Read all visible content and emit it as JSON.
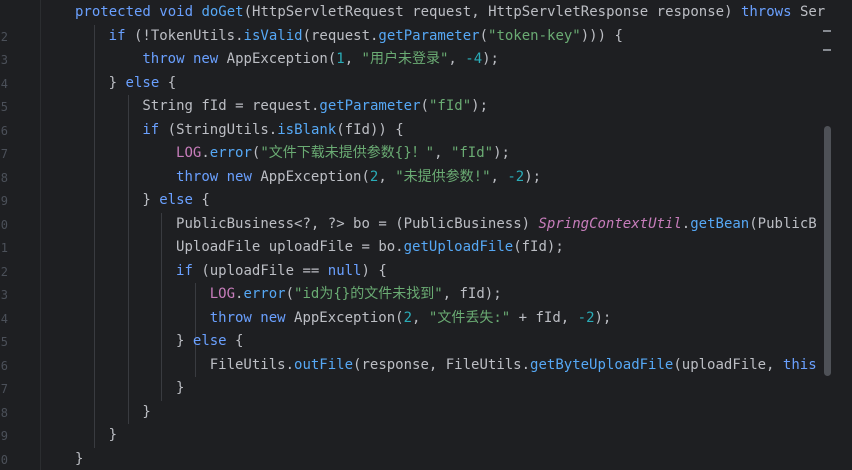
{
  "gutter": {
    "line_numbers": [
      "",
      "2",
      "3",
      "4",
      "5",
      "6",
      "7",
      "8",
      "9",
      "0",
      "1",
      "2",
      "3",
      "4",
      "5",
      "6",
      "7",
      "8",
      "9",
      "0"
    ]
  },
  "code": {
    "lines": [
      {
        "indent": 1,
        "tokens": [
          [
            "k2",
            "protected "
          ],
          [
            "k2",
            "void "
          ],
          [
            "fn",
            "doGet"
          ],
          [
            "tp",
            "("
          ],
          [
            "tp",
            "HttpServletRequest "
          ],
          [
            "tp",
            "request, "
          ],
          [
            "tp",
            "HttpServletResponse "
          ],
          [
            "tp",
            "response) "
          ],
          [
            "k2",
            "throws "
          ],
          [
            "tp",
            "Ser"
          ]
        ]
      },
      {
        "indent": 2,
        "tokens": [
          [
            "k2",
            "if "
          ],
          [
            "tp",
            "(!"
          ],
          [
            "tp",
            "TokenUtils."
          ],
          [
            "fn",
            "isValid"
          ],
          [
            "tp",
            "(request."
          ],
          [
            "fn",
            "getParameter"
          ],
          [
            "tp",
            "("
          ],
          [
            "s",
            "\"token-key\""
          ],
          [
            "tp",
            ")))"
          ],
          [
            "tp",
            " {"
          ]
        ]
      },
      {
        "indent": 3,
        "tokens": [
          [
            "k2",
            "throw "
          ],
          [
            "k2",
            "new "
          ],
          [
            "tp",
            "AppException"
          ],
          [
            "tp",
            "("
          ],
          [
            "n",
            "1"
          ],
          [
            "tp",
            ", "
          ],
          [
            "s",
            "\"用户未登录\""
          ],
          [
            "tp",
            ", "
          ],
          [
            "n",
            "-4"
          ],
          [
            "tp",
            ");"
          ]
        ]
      },
      {
        "indent": 2,
        "tokens": [
          [
            "tp",
            "} "
          ],
          [
            "k2",
            "else "
          ],
          [
            "tp",
            "{"
          ]
        ]
      },
      {
        "indent": 3,
        "tokens": [
          [
            "tp",
            "String "
          ],
          [
            "tp",
            "fId = request."
          ],
          [
            "fn",
            "getParameter"
          ],
          [
            "tp",
            "("
          ],
          [
            "s",
            "\"fId\""
          ],
          [
            "tp",
            ");"
          ]
        ]
      },
      {
        "indent": 3,
        "tokens": [
          [
            "k2",
            "if "
          ],
          [
            "tp",
            "(StringUtils."
          ],
          [
            "fn",
            "isBlank"
          ],
          [
            "tp",
            "(fId)) {"
          ]
        ]
      },
      {
        "indent": 4,
        "tokens": [
          [
            "fd",
            "LOG"
          ],
          [
            "tp",
            "."
          ],
          [
            "fn",
            "error"
          ],
          [
            "tp",
            "("
          ],
          [
            "s",
            "\"文件下载未提供参数{}！\""
          ],
          [
            "tp",
            ", "
          ],
          [
            "s",
            "\"fId\""
          ],
          [
            "tp",
            ");"
          ]
        ]
      },
      {
        "indent": 4,
        "tokens": [
          [
            "k2",
            "throw "
          ],
          [
            "k2",
            "new "
          ],
          [
            "tp",
            "AppException"
          ],
          [
            "tp",
            "("
          ],
          [
            "n",
            "2"
          ],
          [
            "tp",
            ", "
          ],
          [
            "s",
            "\"未提供参数!\""
          ],
          [
            "tp",
            ", "
          ],
          [
            "n",
            "-2"
          ],
          [
            "tp",
            ");"
          ]
        ]
      },
      {
        "indent": 3,
        "tokens": [
          [
            "tp",
            "} "
          ],
          [
            "k2",
            "else "
          ],
          [
            "tp",
            "{"
          ]
        ]
      },
      {
        "indent": 4,
        "tokens": [
          [
            "tp",
            "PublicBusiness"
          ],
          [
            "tp",
            "<?, ?> bo = ("
          ],
          [
            "tp",
            "PublicBusiness"
          ],
          [
            "tp",
            ") "
          ],
          [
            "st",
            "SpringContextUtil"
          ],
          [
            "tp",
            "."
          ],
          [
            "fn",
            "getBean"
          ],
          [
            "tp",
            "(PublicB"
          ]
        ]
      },
      {
        "indent": 4,
        "tokens": [
          [
            "tp",
            "UploadFile "
          ],
          [
            "tp",
            "uploadFile = bo."
          ],
          [
            "fn",
            "getUploadFile"
          ],
          [
            "tp",
            "(fId);"
          ]
        ]
      },
      {
        "indent": 4,
        "tokens": [
          [
            "k2",
            "if "
          ],
          [
            "tp",
            "(uploadFile == "
          ],
          [
            "k2",
            "null"
          ],
          [
            "tp",
            ") {"
          ]
        ]
      },
      {
        "indent": 5,
        "tokens": [
          [
            "fd",
            "LOG"
          ],
          [
            "tp",
            "."
          ],
          [
            "fn",
            "error"
          ],
          [
            "tp",
            "("
          ],
          [
            "s",
            "\"id为{}的文件未找到\""
          ],
          [
            "tp",
            ", fId);"
          ]
        ]
      },
      {
        "indent": 5,
        "tokens": [
          [
            "k2",
            "throw "
          ],
          [
            "k2",
            "new "
          ],
          [
            "tp",
            "AppException"
          ],
          [
            "tp",
            "("
          ],
          [
            "n",
            "2"
          ],
          [
            "tp",
            ", "
          ],
          [
            "s",
            "\"文件丢失:\""
          ],
          [
            "tp",
            " + fId, "
          ],
          [
            "n",
            "-2"
          ],
          [
            "tp",
            ");"
          ]
        ]
      },
      {
        "indent": 4,
        "tokens": [
          [
            "tp",
            "} "
          ],
          [
            "k2",
            "else "
          ],
          [
            "tp",
            "{"
          ]
        ]
      },
      {
        "indent": 5,
        "tokens": [
          [
            "tp",
            "FileUtils."
          ],
          [
            "fn",
            "outFile"
          ],
          [
            "tp",
            "(response, "
          ],
          [
            "tp",
            "FileUtils."
          ],
          [
            "fn",
            "getByteUploadFile"
          ],
          [
            "tp",
            "(uploadFile, "
          ],
          [
            "k2",
            "this"
          ]
        ]
      },
      {
        "indent": 4,
        "tokens": [
          [
            "tp",
            "}"
          ]
        ]
      },
      {
        "indent": 3,
        "tokens": [
          [
            "tp",
            "}"
          ]
        ]
      },
      {
        "indent": 2,
        "tokens": [
          [
            "tp",
            "}"
          ]
        ]
      },
      {
        "indent": 1,
        "tokens": [
          [
            "tp",
            "}"
          ]
        ]
      }
    ]
  },
  "colors": {
    "background": "#1e1f22",
    "keyword": "#6aa0ff",
    "function": "#56a8f5",
    "string": "#6aab73",
    "number": "#2aacb8",
    "field": "#c77dbb"
  }
}
